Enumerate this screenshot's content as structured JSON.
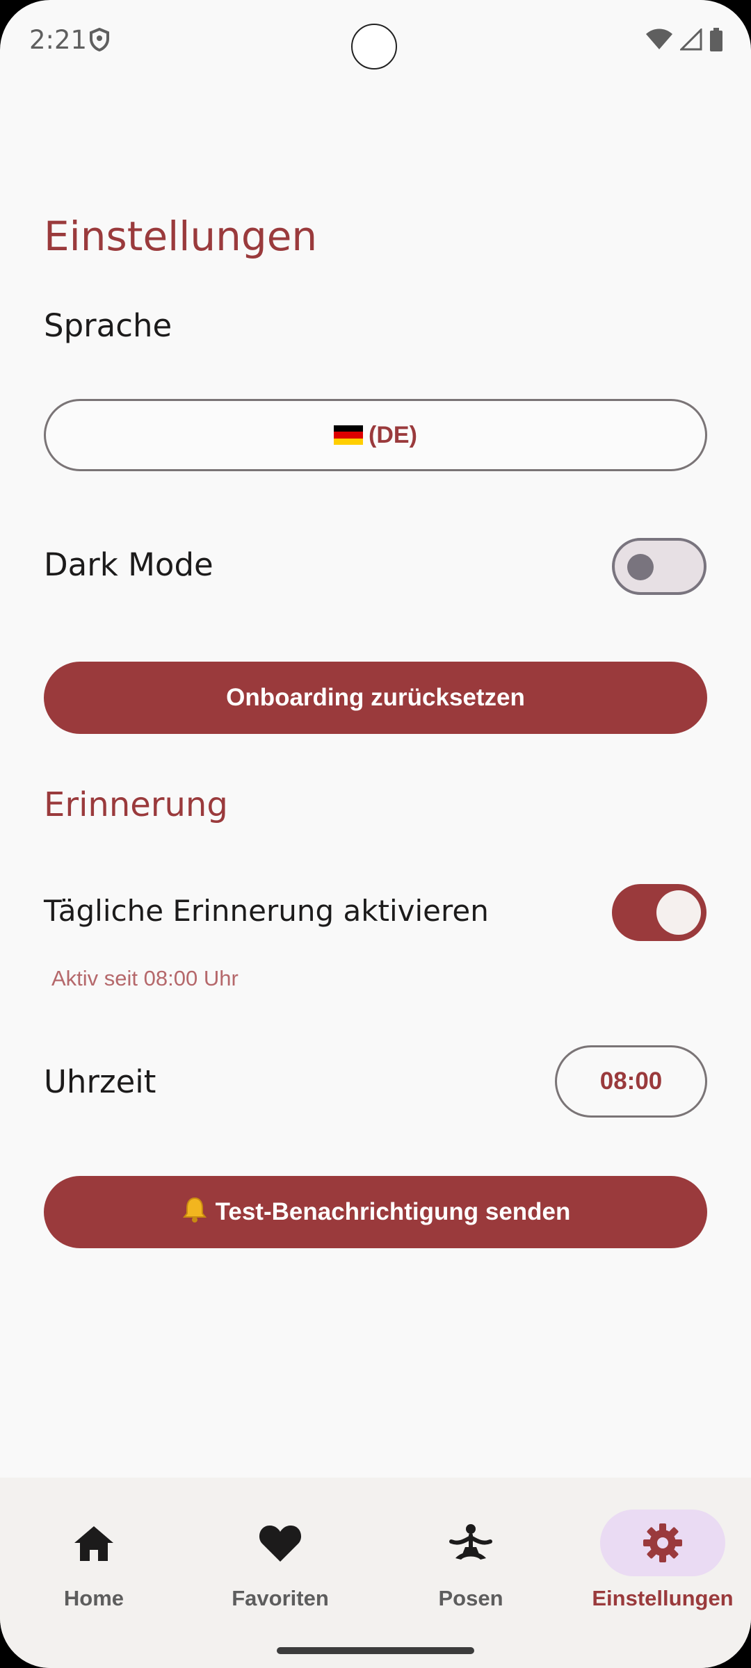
{
  "status_bar": {
    "time": "2:21"
  },
  "page": {
    "title": "Einstellungen"
  },
  "language": {
    "label": "Sprache",
    "button_text": "(DE)"
  },
  "dark_mode": {
    "label": "Dark Mode",
    "enabled": false
  },
  "onboarding": {
    "button_label": "Onboarding zurücksetzen"
  },
  "reminder": {
    "section_title": "Erinnerung",
    "daily_label": "Tägliche Erinnerung aktivieren",
    "daily_enabled": true,
    "helper_text": "Aktiv seit 08:00 Uhr",
    "time_label": "Uhrzeit",
    "time_value": "08:00",
    "test_button_label": "Test-Benachrichtigung senden"
  },
  "nav": {
    "items": [
      {
        "label": "Home",
        "icon": "home-icon"
      },
      {
        "label": "Favoriten",
        "icon": "heart-icon"
      },
      {
        "label": "Posen",
        "icon": "yoga-pose-icon"
      },
      {
        "label": "Einstellungen",
        "icon": "gear-icon",
        "active": true
      }
    ]
  },
  "colors": {
    "accent": "#9a3a3c",
    "nav_active_bg": "#eadbf3"
  }
}
